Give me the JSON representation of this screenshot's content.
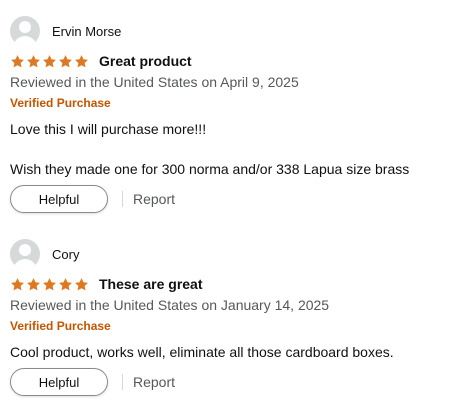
{
  "colors": {
    "star": "#de7921",
    "verified": "#c45500",
    "muted_text": "#565959",
    "text": "#0f1111"
  },
  "icons": {
    "avatar": "default-avatar-icon",
    "star": "star-filled-icon"
  },
  "reviews": [
    {
      "reviewer": "Ervin Morse",
      "rating": 5,
      "title": "Great product",
      "date": "Reviewed in the United States on April 9, 2025",
      "verified": "Verified Purchase",
      "body": [
        "Love this I will purchase more!!!",
        "Wish they made one for 300 norma and/or 338 Lapua size brass"
      ],
      "helpful_label": "Helpful",
      "report_label": "Report"
    },
    {
      "reviewer": "Cory",
      "rating": 5,
      "title": "These are great",
      "date": "Reviewed in the United States on January 14, 2025",
      "verified": "Verified Purchase",
      "body": [
        "Cool product, works well, eliminate all those cardboard boxes."
      ],
      "helpful_label": "Helpful",
      "report_label": "Report"
    }
  ]
}
